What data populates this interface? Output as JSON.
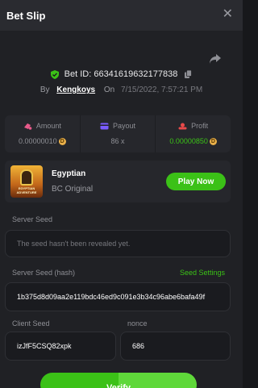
{
  "header": {
    "title": "Bet Slip",
    "close_icon": "close-icon"
  },
  "bet": {
    "id_label": "Bet ID:",
    "id_value": "66341619632177838",
    "by_label": "By",
    "user": "Kengkoys",
    "on_label": "On",
    "date": "7/15/2022, 7:57:21 PM"
  },
  "stats": {
    "amount_label": "Amount",
    "amount_value": "0.00000010",
    "payout_label": "Payout",
    "payout_value": "86 x",
    "profit_label": "Profit",
    "profit_value": "0.00000850"
  },
  "game": {
    "name": "Egyptian",
    "provider": "BC Original",
    "thumb_caption": "EGYPTIAN ADVENTURE",
    "play_label": "Play Now"
  },
  "seeds": {
    "server_seed_label": "Server Seed",
    "server_seed_placeholder": "The seed hasn't been revealed yet.",
    "server_hash_label": "Server Seed (hash)",
    "settings_link": "Seed Settings",
    "server_hash_value": "1b375d8d09aa2e119bdc46ed9c091e3b34c96abe6bafa49f",
    "client_seed_label": "Client Seed",
    "client_seed_value": "izJfF5CSQ82xpk",
    "nonce_label": "nonce",
    "nonce_value": "686"
  },
  "actions": {
    "verify_label": "Verify"
  },
  "colors": {
    "accent": "#3bc117",
    "background": "#202125",
    "card": "#26272c"
  }
}
